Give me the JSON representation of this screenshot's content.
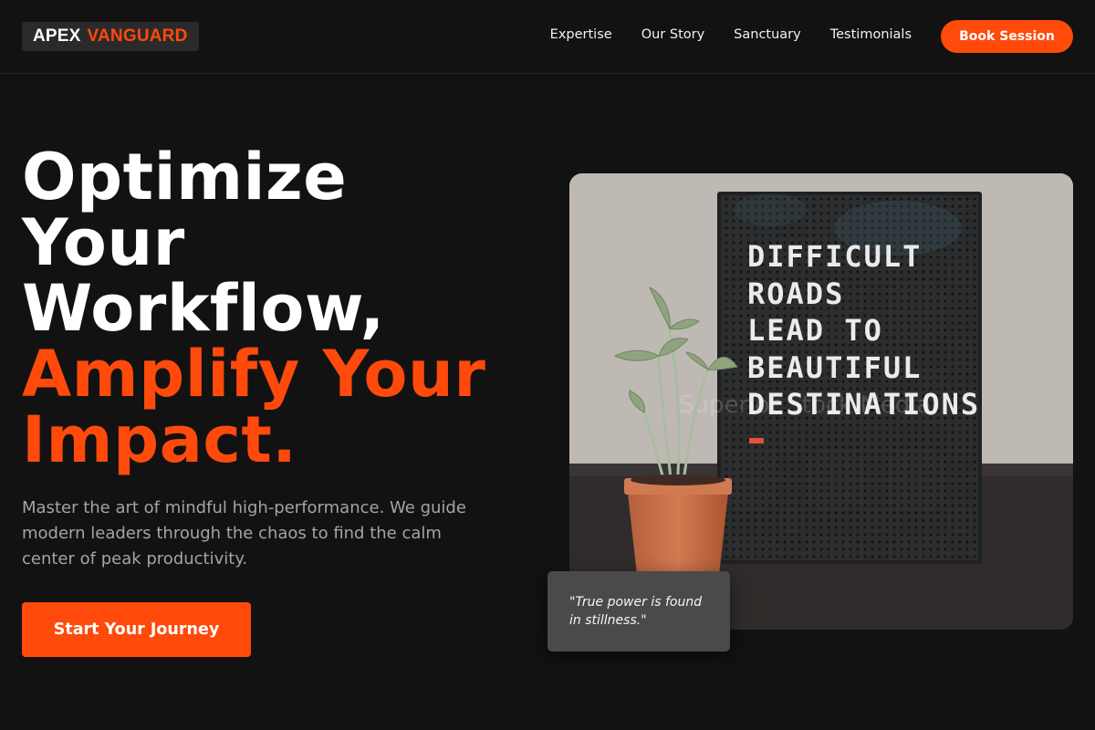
{
  "brand": {
    "part1": "APEX",
    "part2": "VANGUARD",
    "accent_color": "#ff4a0b"
  },
  "nav": {
    "links": [
      "Expertise",
      "Our Story",
      "Sanctuary",
      "Testimonials"
    ],
    "cta_label": "Book Session"
  },
  "hero": {
    "title_lines": [
      "Optimize",
      "Your",
      "Workflow,"
    ],
    "title_accent_lines": [
      "Amplify Your",
      "Impact."
    ],
    "lead": "Master the art of mindful high-performance. We guide modern leaders through the chaos to find the calm center of peak productivity.",
    "cta_label": "Start Your Journey"
  },
  "image": {
    "letterboard_lines": [
      "DIFFICULT",
      "ROADS",
      "LEAD TO",
      "BEAUTIFUL",
      "DESTINATIONS"
    ],
    "watermark": "Superior Stock Media"
  },
  "quote": {
    "text": "\"True power is found in stillness.\""
  }
}
